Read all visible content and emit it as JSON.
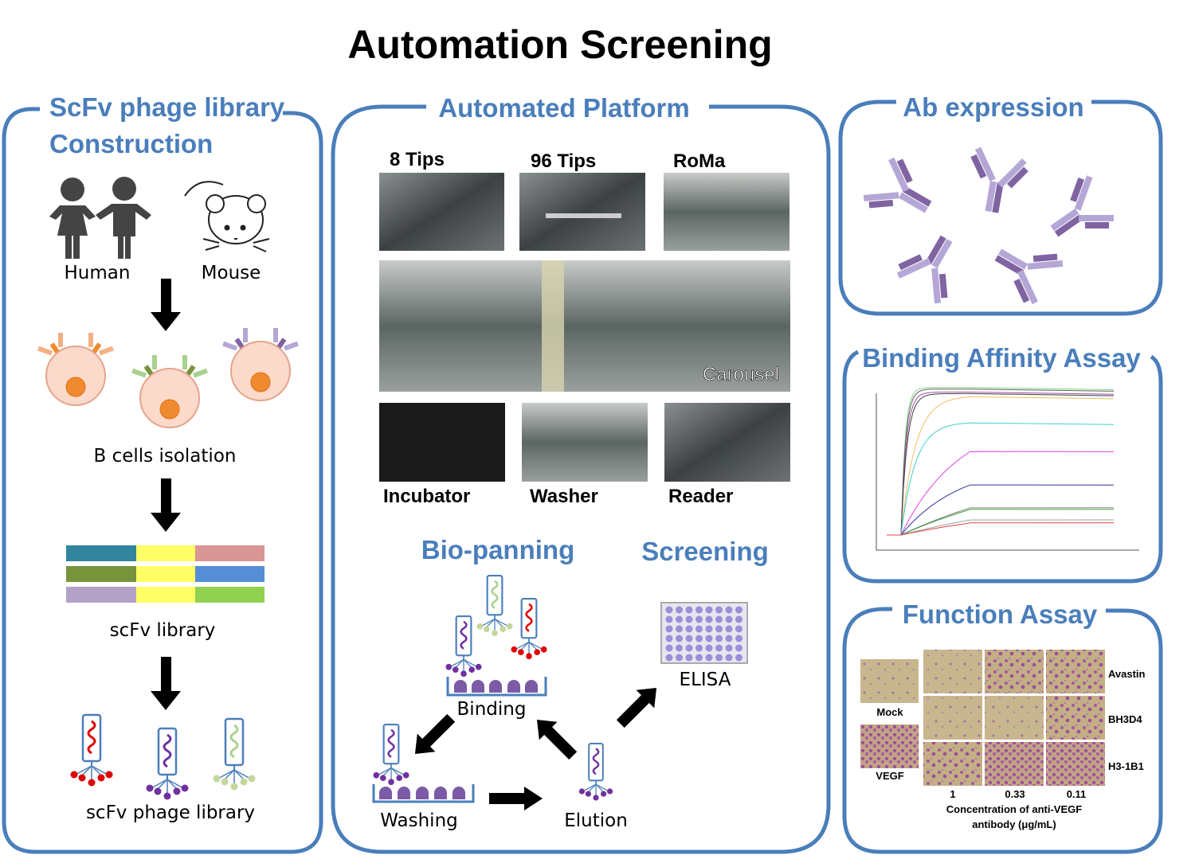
{
  "title": "Automation Screening",
  "colors": {
    "panel_border": "#4a7ebb",
    "heading": "#4a7ebb",
    "antibody_light": "#b4a7d6",
    "antibody_dark": "#8064a2"
  },
  "library_panel": {
    "heading_line1": "ScFv phage library",
    "heading_line2": "Construction",
    "sources": [
      "Human",
      "Mouse"
    ],
    "step_cells": "B cells isolation",
    "step_library": "scFv library",
    "step_phage": "scFv phage library"
  },
  "platform_panel": {
    "heading": "Automated Platform",
    "modules_top": [
      "8 Tips",
      "96 Tips",
      "RoMa"
    ],
    "carousel": "Carousel",
    "modules_bottom": [
      "Incubator",
      "Washer",
      "Reader"
    ],
    "biopanning": "Bio-panning",
    "screening": "Screening",
    "cycle": {
      "binding": "Binding",
      "washing": "Washing",
      "elution": "Elution",
      "elisa": "ELISA"
    }
  },
  "ab_panel": {
    "heading": "Ab expression"
  },
  "binding_panel": {
    "heading": "Binding Affinity Assay",
    "curves": [
      {
        "color": "#7fd67f",
        "plateau": 96
      },
      {
        "color": "#606060",
        "plateau": 95
      },
      {
        "color": "#a050a0",
        "plateau": 93
      },
      {
        "color": "#404040",
        "plateau": 92
      },
      {
        "color": "#f0c060",
        "plateau": 90
      },
      {
        "color": "#40d0d0",
        "plateau": 73
      },
      {
        "color": "#e040e0",
        "plateau": 55
      },
      {
        "color": "#3030a0",
        "plateau": 33
      },
      {
        "color": "#808080",
        "plateau": 18
      },
      {
        "color": "#40a040",
        "plateau": 17
      },
      {
        "color": "#a0a0a0",
        "plateau": 10
      },
      {
        "color": "#e04040",
        "plateau": 8
      }
    ]
  },
  "function_panel": {
    "heading": "Function Assay",
    "controls": [
      "Mock",
      "VEGF"
    ],
    "antibodies": [
      "Avastin",
      "BH3D4",
      "H3-1B1"
    ],
    "concentrations": [
      "1",
      "0.33",
      "0.11"
    ],
    "xlabel_line1": "Concentration of anti-VEGF",
    "xlabel_line2": "antibody (μg/mL)"
  }
}
